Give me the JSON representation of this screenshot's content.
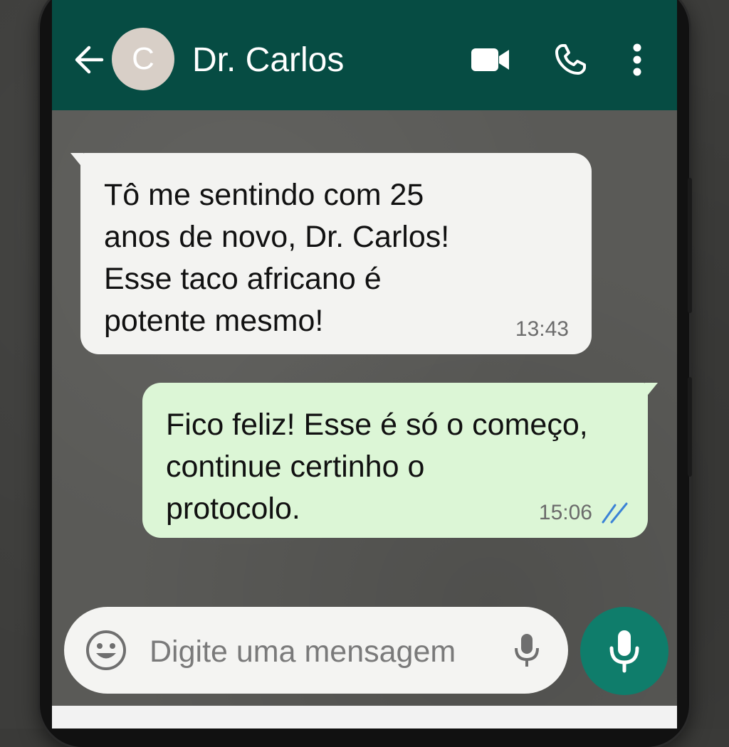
{
  "header": {
    "avatar_letter": "C",
    "contact_name": "Dr. Carlos",
    "colors": {
      "bar": "#064c43",
      "avatar": "#d8cfc7"
    },
    "icons": [
      "arrow-left-icon",
      "video-camera-icon",
      "phone-icon",
      "more-vertical-icon"
    ]
  },
  "messages": [
    {
      "direction": "incoming",
      "text": "Tô me sentindo com 25\nanos de novo, Dr. Carlos!\nEsse taco africano é\npotente mesmo!",
      "time": "13:43"
    },
    {
      "direction": "outgoing",
      "text": "Fico feliz! Esse é só o começo,\ncontinue certinho o\nprotocolo.",
      "time": "15:06",
      "status_icon": "double-check-read-icon"
    }
  ],
  "composer": {
    "placeholder": "Digite uma mensagem",
    "icons": [
      "emoji-icon",
      "microphone-icon"
    ],
    "send_button_icon": "microphone-icon",
    "colors": {
      "send_button": "#0f7d6b",
      "outgoing_bubble": "#dcf6d6",
      "read_ticks": "#3b82d6"
    }
  }
}
